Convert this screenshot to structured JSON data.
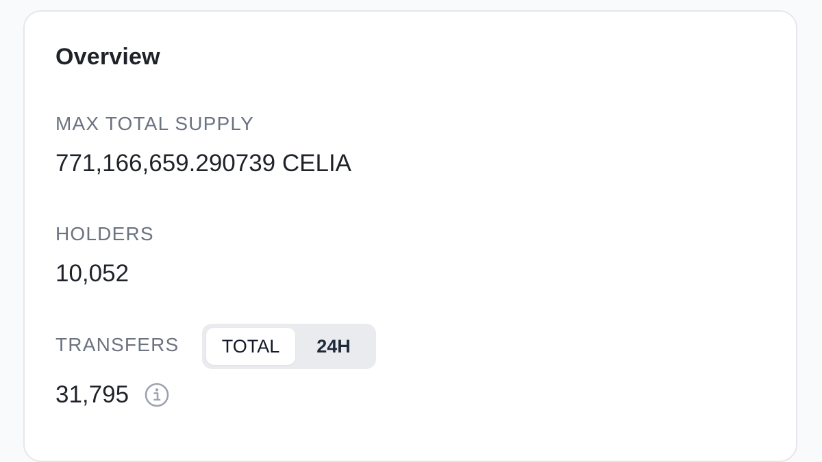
{
  "overview": {
    "title": "Overview",
    "max_total_supply": {
      "label": "MAX TOTAL SUPPLY",
      "value": "771,166,659.290739 CELIA"
    },
    "holders": {
      "label": "HOLDERS",
      "value": "10,052"
    },
    "transfers": {
      "label": "TRANSFERS",
      "value": "31,795",
      "toggle": {
        "options": [
          "TOTAL",
          "24H"
        ],
        "selected": "TOTAL"
      },
      "info_icon": "info-icon"
    }
  }
}
